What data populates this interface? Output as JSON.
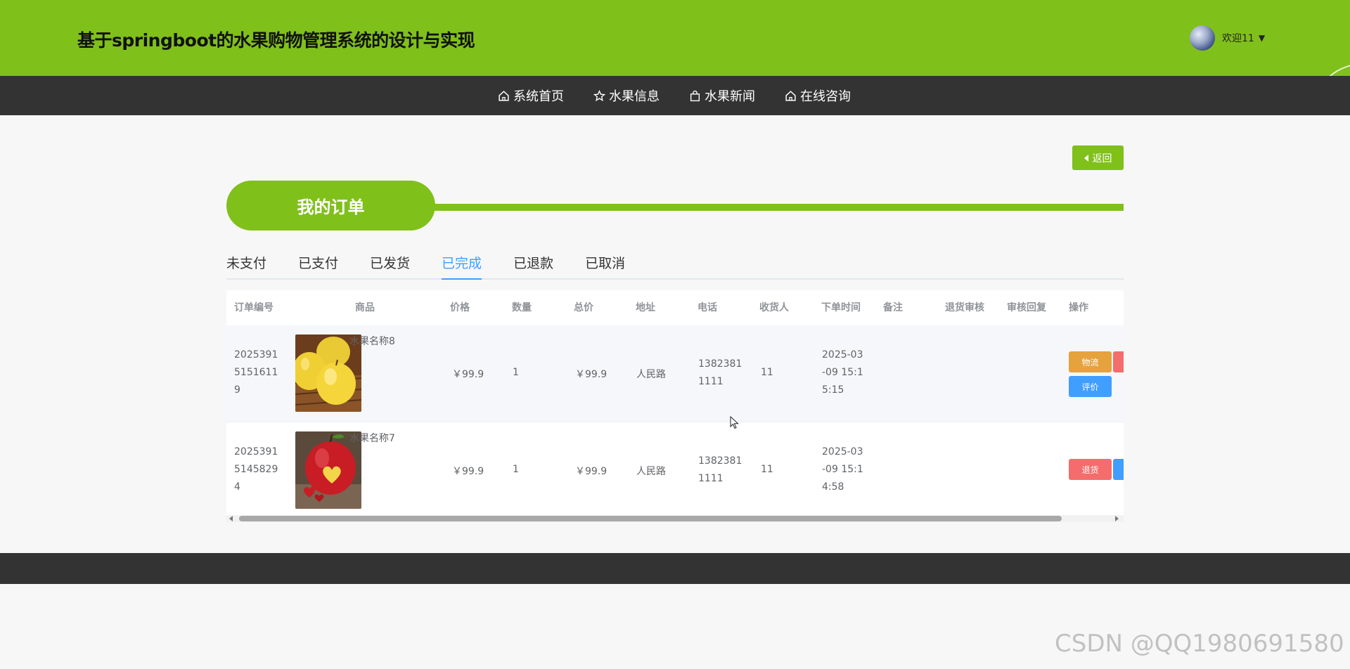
{
  "header": {
    "title": "基于springboot的水果购物管理系统的设计与实现",
    "welcome": "欢迎11",
    "caret": "▼"
  },
  "nav": [
    {
      "label": "系统首页",
      "icon": "home-icon"
    },
    {
      "label": "水果信息",
      "icon": "star-icon"
    },
    {
      "label": "水果新闻",
      "icon": "bag-icon"
    },
    {
      "label": "在线咨询",
      "icon": "home-icon"
    }
  ],
  "back": {
    "label": "返回"
  },
  "section_title": "我的订单",
  "tabs": [
    "未支付",
    "已支付",
    "已发货",
    "已完成",
    "已退款",
    "已取消"
  ],
  "active_tab": "已完成",
  "table": {
    "headers": [
      "订单编号",
      "商品",
      "价格",
      "数量",
      "总价",
      "地址",
      "电话",
      "收货人",
      "下单时间",
      "备注",
      "退货审核",
      "审核回复",
      "操作"
    ],
    "rows": [
      {
        "order_no": [
          "2025391",
          "5151611",
          "9"
        ],
        "product": "水果名称8",
        "image": "yellow-apples",
        "price": "￥99.9",
        "qty": "1",
        "total": "￥99.9",
        "address": "人民路",
        "phone": [
          "1382381",
          "1111"
        ],
        "receiver": "11",
        "time": [
          "2025-03",
          "-09 15:1",
          "5:15"
        ],
        "remark": "",
        "return_review": "",
        "review_reply": "",
        "actions": [
          "物流",
          "评价"
        ]
      },
      {
        "order_no": [
          "2025391",
          "5145829",
          "4"
        ],
        "product": "水果名称7",
        "image": "red-apple-heart",
        "price": "￥99.9",
        "qty": "1",
        "total": "￥99.9",
        "address": "人民路",
        "phone": [
          "1382381",
          "1111"
        ],
        "receiver": "11",
        "time": [
          "2025-03",
          "-09 15:1",
          "4:58"
        ],
        "remark": "",
        "return_review": "",
        "review_reply": "",
        "actions": [
          "退货"
        ]
      }
    ]
  },
  "watermark": "CSDN @QQ1980691580",
  "colors": {
    "brand": "#80c01b",
    "nav_bg": "#333333",
    "tab_active": "#409eff",
    "warning": "#e6a23c",
    "danger": "#f56c6c",
    "primary": "#409eff"
  }
}
